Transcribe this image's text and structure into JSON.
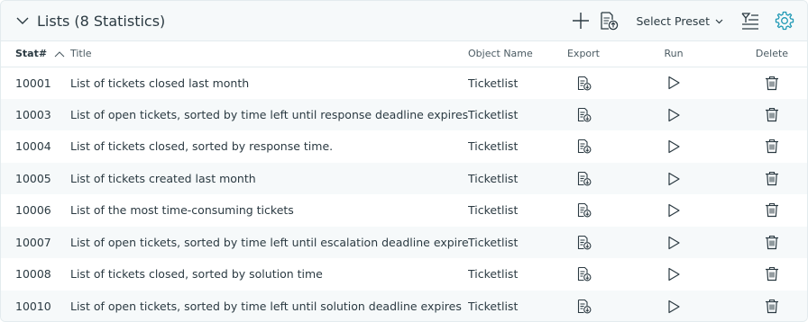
{
  "header": {
    "title": "Lists (8 Statistics)",
    "preset_label": "Select Preset"
  },
  "columns": {
    "stat": "Stat#",
    "title": "Title",
    "object": "Object Name",
    "export": "Export",
    "run": "Run",
    "delete": "Delete"
  },
  "rows": [
    {
      "stat": "10001",
      "title": "List of tickets closed last month",
      "object": "Ticketlist"
    },
    {
      "stat": "10003",
      "title": "List of open tickets, sorted by time left until response deadline expires",
      "object": "Ticketlist"
    },
    {
      "stat": "10004",
      "title": "List of tickets closed, sorted by response time.",
      "object": "Ticketlist"
    },
    {
      "stat": "10005",
      "title": "List of tickets created last month",
      "object": "Ticketlist"
    },
    {
      "stat": "10006",
      "title": "List of the most time-consuming tickets",
      "object": "Ticketlist"
    },
    {
      "stat": "10007",
      "title": "List of open tickets, sorted by time left until escalation deadline expires",
      "object": "Ticketlist"
    },
    {
      "stat": "10008",
      "title": "List of tickets closed, sorted by solution time",
      "object": "Ticketlist"
    },
    {
      "stat": "10010",
      "title": "List of open tickets, sorted by time left until solution deadline expires",
      "object": "Ticketlist"
    }
  ],
  "icons": {
    "collapse": "chevron-down-icon",
    "add": "plus-icon",
    "import": "document-upload-icon",
    "preset": "chevron-down-icon",
    "filter": "filter-list-icon",
    "settings": "gear-icon",
    "sort": "sort-ascending-icon",
    "export": "document-download-icon",
    "run": "play-icon",
    "delete": "trash-icon"
  },
  "colors": {
    "accent": "#1d98b4",
    "text": "#2b3a42",
    "header_bg": "#f6f9fa",
    "stripe": "#f6f9fa"
  }
}
